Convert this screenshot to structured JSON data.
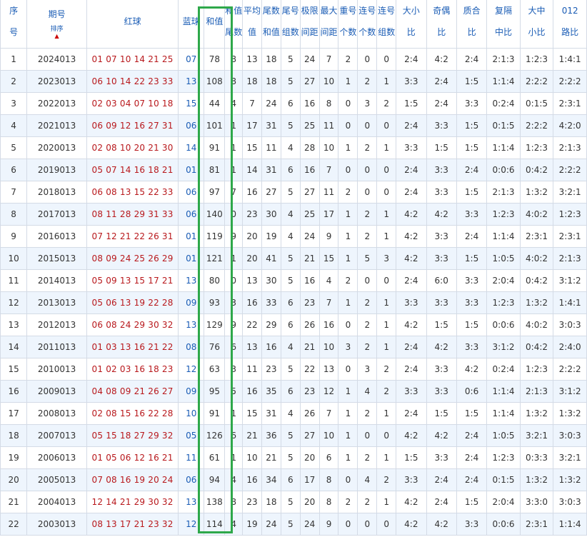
{
  "headers": {
    "seq": [
      "序",
      "号"
    ],
    "issue": "期号",
    "sort_label": "排序",
    "red": "红球",
    "blue": "蓝球",
    "sum": "和值",
    "sum_tail": [
      "和值",
      "尾数"
    ],
    "avg": [
      "平均",
      "值"
    ],
    "tail_sum": [
      "尾数",
      "和值"
    ],
    "tail_group": [
      "尾号",
      "组数"
    ],
    "range": [
      "极限",
      "间距"
    ],
    "max_gap": [
      "最大",
      "间距"
    ],
    "repeat": [
      "重号",
      "个数"
    ],
    "consec": [
      "连号",
      "个数"
    ],
    "consec_group": [
      "连号",
      "组数"
    ],
    "big_small": [
      "大小",
      "比"
    ],
    "odd_even": [
      "奇偶",
      "比"
    ],
    "prime": [
      "质合",
      "比"
    ],
    "mod3_ratio": [
      "复隔",
      "中比"
    ],
    "bms": [
      "大中",
      "小比"
    ],
    "road": [
      "012",
      "路比"
    ]
  },
  "rows": [
    {
      "seq": "1",
      "issue": "2024013",
      "red": "01 07 10 14 21 25",
      "blue": "07",
      "sum": "78",
      "tail": "8",
      "avg": "13",
      "tsum": "18",
      "tgroup": "5",
      "range": "24",
      "maxgap": "7",
      "rep": "2",
      "con": "0",
      "cg": "0",
      "bs": "2:4",
      "oe": "4:2",
      "pc": "2:4",
      "m3": "2:1:3",
      "bms": "1:2:3",
      "road": "1:4:1"
    },
    {
      "seq": "2",
      "issue": "2023013",
      "red": "06 10 14 22 23 33",
      "blue": "13",
      "sum": "108",
      "tail": "8",
      "avg": "18",
      "tsum": "18",
      "tgroup": "5",
      "range": "27",
      "maxgap": "10",
      "rep": "1",
      "con": "2",
      "cg": "1",
      "bs": "3:3",
      "oe": "2:4",
      "pc": "1:5",
      "m3": "1:1:4",
      "bms": "2:2:2",
      "road": "2:2:2"
    },
    {
      "seq": "3",
      "issue": "2022013",
      "red": "02 03 04 07 10 18",
      "blue": "15",
      "sum": "44",
      "tail": "4",
      "avg": "7",
      "tsum": "24",
      "tgroup": "6",
      "range": "16",
      "maxgap": "8",
      "rep": "0",
      "con": "3",
      "cg": "2",
      "bs": "1:5",
      "oe": "2:4",
      "pc": "3:3",
      "m3": "0:2:4",
      "bms": "0:1:5",
      "road": "2:3:1"
    },
    {
      "seq": "4",
      "issue": "2021013",
      "red": "06 09 12 16 27 31",
      "blue": "06",
      "sum": "101",
      "tail": "1",
      "avg": "17",
      "tsum": "31",
      "tgroup": "5",
      "range": "25",
      "maxgap": "11",
      "rep": "0",
      "con": "0",
      "cg": "0",
      "bs": "2:4",
      "oe": "3:3",
      "pc": "1:5",
      "m3": "0:1:5",
      "bms": "2:2:2",
      "road": "4:2:0"
    },
    {
      "seq": "5",
      "issue": "2020013",
      "red": "02 08 10 20 21 30",
      "blue": "14",
      "sum": "91",
      "tail": "1",
      "avg": "15",
      "tsum": "11",
      "tgroup": "4",
      "range": "28",
      "maxgap": "10",
      "rep": "1",
      "con": "2",
      "cg": "1",
      "bs": "3:3",
      "oe": "1:5",
      "pc": "1:5",
      "m3": "1:1:4",
      "bms": "1:2:3",
      "road": "2:1:3"
    },
    {
      "seq": "6",
      "issue": "2019013",
      "red": "05 07 14 16 18 21",
      "blue": "01",
      "sum": "81",
      "tail": "1",
      "avg": "14",
      "tsum": "31",
      "tgroup": "6",
      "range": "16",
      "maxgap": "7",
      "rep": "0",
      "con": "0",
      "cg": "0",
      "bs": "2:4",
      "oe": "3:3",
      "pc": "2:4",
      "m3": "0:0:6",
      "bms": "0:4:2",
      "road": "2:2:2"
    },
    {
      "seq": "7",
      "issue": "2018013",
      "red": "06 08 13 15 22 33",
      "blue": "06",
      "sum": "97",
      "tail": "7",
      "avg": "16",
      "tsum": "27",
      "tgroup": "5",
      "range": "27",
      "maxgap": "11",
      "rep": "2",
      "con": "0",
      "cg": "0",
      "bs": "2:4",
      "oe": "3:3",
      "pc": "1:5",
      "m3": "2:1:3",
      "bms": "1:3:2",
      "road": "3:2:1"
    },
    {
      "seq": "8",
      "issue": "2017013",
      "red": "08 11 28 29 31 33",
      "blue": "06",
      "sum": "140",
      "tail": "0",
      "avg": "23",
      "tsum": "30",
      "tgroup": "4",
      "range": "25",
      "maxgap": "17",
      "rep": "1",
      "con": "2",
      "cg": "1",
      "bs": "4:2",
      "oe": "4:2",
      "pc": "3:3",
      "m3": "1:2:3",
      "bms": "4:0:2",
      "road": "1:2:3"
    },
    {
      "seq": "9",
      "issue": "2016013",
      "red": "07 12 21 22 26 31",
      "blue": "01",
      "sum": "119",
      "tail": "9",
      "avg": "20",
      "tsum": "19",
      "tgroup": "4",
      "range": "24",
      "maxgap": "9",
      "rep": "1",
      "con": "2",
      "cg": "1",
      "bs": "4:2",
      "oe": "3:3",
      "pc": "2:4",
      "m3": "1:1:4",
      "bms": "2:3:1",
      "road": "2:3:1"
    },
    {
      "seq": "10",
      "issue": "2015013",
      "red": "08 09 24 25 26 29",
      "blue": "01",
      "sum": "121",
      "tail": "1",
      "avg": "20",
      "tsum": "41",
      "tgroup": "5",
      "range": "21",
      "maxgap": "15",
      "rep": "1",
      "con": "5",
      "cg": "3",
      "bs": "4:2",
      "oe": "3:3",
      "pc": "1:5",
      "m3": "1:0:5",
      "bms": "4:0:2",
      "road": "2:1:3"
    },
    {
      "seq": "11",
      "issue": "2014013",
      "red": "05 09 13 15 17 21",
      "blue": "13",
      "sum": "80",
      "tail": "0",
      "avg": "13",
      "tsum": "30",
      "tgroup": "5",
      "range": "16",
      "maxgap": "4",
      "rep": "2",
      "con": "0",
      "cg": "0",
      "bs": "2:4",
      "oe": "6:0",
      "pc": "3:3",
      "m3": "2:0:4",
      "bms": "0:4:2",
      "road": "3:1:2"
    },
    {
      "seq": "12",
      "issue": "2013013",
      "red": "05 06 13 19 22 28",
      "blue": "09",
      "sum": "93",
      "tail": "3",
      "avg": "16",
      "tsum": "33",
      "tgroup": "6",
      "range": "23",
      "maxgap": "7",
      "rep": "1",
      "con": "2",
      "cg": "1",
      "bs": "3:3",
      "oe": "3:3",
      "pc": "3:3",
      "m3": "1:2:3",
      "bms": "1:3:2",
      "road": "1:4:1"
    },
    {
      "seq": "13",
      "issue": "2012013",
      "red": "06 08 24 29 30 32",
      "blue": "13",
      "sum": "129",
      "tail": "9",
      "avg": "22",
      "tsum": "29",
      "tgroup": "6",
      "range": "26",
      "maxgap": "16",
      "rep": "0",
      "con": "2",
      "cg": "1",
      "bs": "4:2",
      "oe": "1:5",
      "pc": "1:5",
      "m3": "0:0:6",
      "bms": "4:0:2",
      "road": "3:0:3"
    },
    {
      "seq": "14",
      "issue": "2011013",
      "red": "01 03 13 16 21 22",
      "blue": "08",
      "sum": "76",
      "tail": "6",
      "avg": "13",
      "tsum": "16",
      "tgroup": "4",
      "range": "21",
      "maxgap": "10",
      "rep": "3",
      "con": "2",
      "cg": "1",
      "bs": "2:4",
      "oe": "4:2",
      "pc": "3:3",
      "m3": "3:1:2",
      "bms": "0:4:2",
      "road": "2:4:0"
    },
    {
      "seq": "15",
      "issue": "2010013",
      "red": "01 02 03 16 18 23",
      "blue": "12",
      "sum": "63",
      "tail": "3",
      "avg": "11",
      "tsum": "23",
      "tgroup": "5",
      "range": "22",
      "maxgap": "13",
      "rep": "0",
      "con": "3",
      "cg": "2",
      "bs": "2:4",
      "oe": "3:3",
      "pc": "4:2",
      "m3": "0:2:4",
      "bms": "1:2:3",
      "road": "2:2:2"
    },
    {
      "seq": "16",
      "issue": "2009013",
      "red": "04 08 09 21 26 27",
      "blue": "09",
      "sum": "95",
      "tail": "5",
      "avg": "16",
      "tsum": "35",
      "tgroup": "6",
      "range": "23",
      "maxgap": "12",
      "rep": "1",
      "con": "4",
      "cg": "2",
      "bs": "3:3",
      "oe": "3:3",
      "pc": "0:6",
      "m3": "1:1:4",
      "bms": "2:1:3",
      "road": "3:1:2"
    },
    {
      "seq": "17",
      "issue": "2008013",
      "red": "02 08 15 16 22 28",
      "blue": "10",
      "sum": "91",
      "tail": "1",
      "avg": "15",
      "tsum": "31",
      "tgroup": "4",
      "range": "26",
      "maxgap": "7",
      "rep": "1",
      "con": "2",
      "cg": "1",
      "bs": "2:4",
      "oe": "1:5",
      "pc": "1:5",
      "m3": "1:1:4",
      "bms": "1:3:2",
      "road": "1:3:2"
    },
    {
      "seq": "18",
      "issue": "2007013",
      "red": "05 15 18 27 29 32",
      "blue": "05",
      "sum": "126",
      "tail": "6",
      "avg": "21",
      "tsum": "36",
      "tgroup": "5",
      "range": "27",
      "maxgap": "10",
      "rep": "1",
      "con": "0",
      "cg": "0",
      "bs": "4:2",
      "oe": "4:2",
      "pc": "2:4",
      "m3": "1:0:5",
      "bms": "3:2:1",
      "road": "3:0:3"
    },
    {
      "seq": "19",
      "issue": "2006013",
      "red": "01 05 06 12 16 21",
      "blue": "11",
      "sum": "61",
      "tail": "1",
      "avg": "10",
      "tsum": "21",
      "tgroup": "5",
      "range": "20",
      "maxgap": "6",
      "rep": "1",
      "con": "2",
      "cg": "1",
      "bs": "1:5",
      "oe": "3:3",
      "pc": "2:4",
      "m3": "1:2:3",
      "bms": "0:3:3",
      "road": "3:2:1"
    },
    {
      "seq": "20",
      "issue": "2005013",
      "red": "07 08 16 19 20 24",
      "blue": "06",
      "sum": "94",
      "tail": "4",
      "avg": "16",
      "tsum": "34",
      "tgroup": "6",
      "range": "17",
      "maxgap": "8",
      "rep": "0",
      "con": "4",
      "cg": "2",
      "bs": "3:3",
      "oe": "2:4",
      "pc": "2:4",
      "m3": "0:1:5",
      "bms": "1:3:2",
      "road": "1:3:2"
    },
    {
      "seq": "21",
      "issue": "2004013",
      "red": "12 14 21 29 30 32",
      "blue": "13",
      "sum": "138",
      "tail": "8",
      "avg": "23",
      "tsum": "18",
      "tgroup": "5",
      "range": "20",
      "maxgap": "8",
      "rep": "2",
      "con": "2",
      "cg": "1",
      "bs": "4:2",
      "oe": "2:4",
      "pc": "1:5",
      "m3": "2:0:4",
      "bms": "3:3:0",
      "road": "3:0:3"
    },
    {
      "seq": "22",
      "issue": "2003013",
      "red": "08 13 17 21 23 32",
      "blue": "12",
      "sum": "114",
      "tail": "4",
      "avg": "19",
      "tsum": "24",
      "tgroup": "5",
      "range": "24",
      "maxgap": "9",
      "rep": "0",
      "con": "0",
      "cg": "0",
      "bs": "4:2",
      "oe": "4:2",
      "pc": "3:3",
      "m3": "0:0:6",
      "bms": "2:3:1",
      "road": "1:1:4"
    }
  ]
}
